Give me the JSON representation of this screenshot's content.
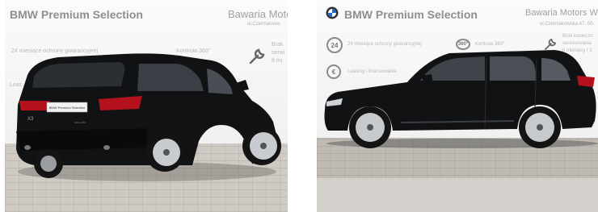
{
  "photos": [
    {
      "view": "rear three-quarter",
      "banner": {
        "title": "BMW Premium Selection",
        "dealer": "Bawaria Motors",
        "address": "ul.Czerniakows",
        "warranty": "24 miesiące ochrony gwarancyjnej",
        "inspection": "Kontrola 360°",
        "service": [
          "Brak",
          "serwi",
          "6 mi"
        ],
        "leasing": "Leas"
      },
      "car": {
        "badge": "X3",
        "plate": "BMW Premium Selection",
        "model_badge": "sDrive18d"
      }
    },
    {
      "view": "side profile",
      "banner": {
        "title": "BMW Premium Selection",
        "dealer": "Bawaria Motors Wa",
        "address": "ul.Czerniakowska 47, 00-",
        "warranty_icon": "24",
        "warranty": "24 miesiące ochrony gwarancyjnej",
        "inspection_icon": "360°",
        "inspection": "Kontrola 360°",
        "leasing": "Leasing i finansowanie",
        "service": [
          "Brak konieczn",
          "serwisowania",
          "6 miesięcy / 1"
        ]
      }
    }
  ],
  "colors": {
    "car_body": "#111214",
    "banner_text": "#8f8f8f",
    "pavement": "#cfcac4"
  }
}
